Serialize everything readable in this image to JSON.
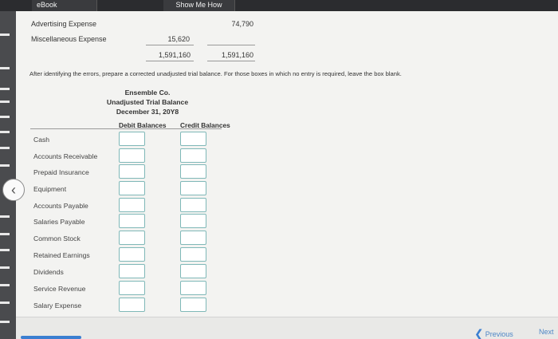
{
  "toolbar": {
    "ebook_tab": "eBook",
    "show_me_how_tab": "Show Me How"
  },
  "previous_section": {
    "rows": [
      {
        "label": "Advertising Expense",
        "credit": "74,790"
      },
      {
        "label": "Miscellaneous Expense",
        "debit": "15,620"
      }
    ],
    "totals": {
      "debit": "1,591,160",
      "credit": "1,591,160"
    }
  },
  "instruction": "After identifying the errors, prepare a corrected unadjusted trial balance. For those boxes in which no entry is required, leave the box blank.",
  "trial_balance": {
    "company": "Ensemble Co.",
    "title": "Unadjusted Trial Balance",
    "date": "December 31, 20Y8",
    "debit_header": "Debit Balances",
    "credit_header": "Credit Balances",
    "accounts": [
      {
        "name": "Cash",
        "debit": "",
        "credit": ""
      },
      {
        "name": "Accounts Receivable",
        "debit": "",
        "credit": ""
      },
      {
        "name": "Prepaid Insurance",
        "debit": "",
        "credit": ""
      },
      {
        "name": "Equipment",
        "debit": "",
        "credit": ""
      },
      {
        "name": "Accounts Payable",
        "debit": "",
        "credit": ""
      },
      {
        "name": "Salaries Payable",
        "debit": "",
        "credit": ""
      },
      {
        "name": "Common Stock",
        "debit": "",
        "credit": ""
      },
      {
        "name": "Retained Earnings",
        "debit": "",
        "credit": ""
      },
      {
        "name": "Dividends",
        "debit": "",
        "credit": ""
      },
      {
        "name": "Service Revenue",
        "debit": "",
        "credit": ""
      },
      {
        "name": "Salary Expense",
        "debit": "",
        "credit": ""
      }
    ]
  },
  "footer": {
    "previous_label": "Previous",
    "next_label": "Next"
  },
  "icons": {
    "left_nav": "chevron-left-icon",
    "previous": "chevron-left-icon"
  },
  "colors": {
    "input_border": "#7fb8b8",
    "link": "#4d86c6"
  }
}
